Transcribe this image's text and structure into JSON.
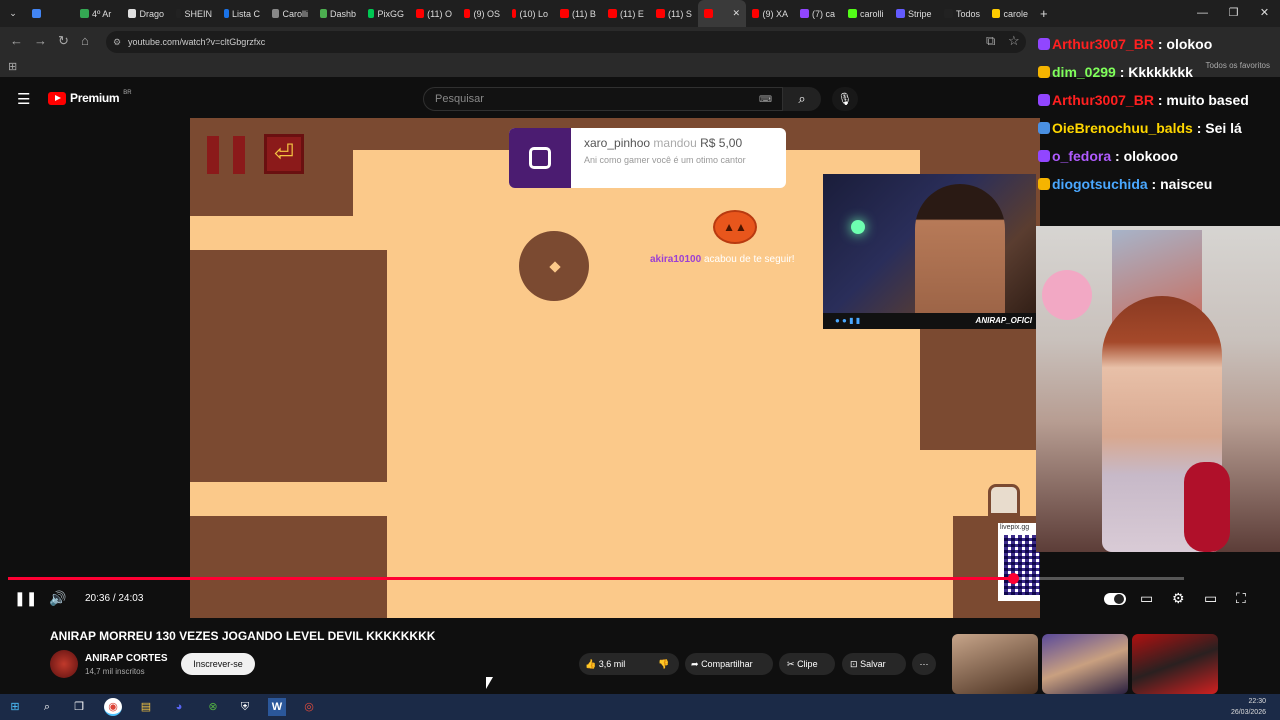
{
  "browser": {
    "tabs": [
      {
        "label": "",
        "color": "#4285f4"
      },
      {
        "label": "4º Ar",
        "color": "#34a853"
      },
      {
        "label": "Drago",
        "color": "#e0e0e0"
      },
      {
        "label": "SHEIN",
        "color": "#222222"
      },
      {
        "label": "Lista C",
        "color": "#1a73e8"
      },
      {
        "label": "Carolli",
        "color": "#888888"
      },
      {
        "label": "Dashb",
        "color": "#4caf50"
      },
      {
        "label": "PixGG",
        "color": "#00c853"
      },
      {
        "label": "(11) O",
        "color": "#ff0000"
      },
      {
        "label": "(9) OS",
        "color": "#ff0000"
      },
      {
        "label": "(10) Lo",
        "color": "#ff0000"
      },
      {
        "label": "(11) B",
        "color": "#ff0000"
      },
      {
        "label": "(11) E",
        "color": "#ff0000"
      },
      {
        "label": "(11) S",
        "color": "#ff0000"
      },
      {
        "label": "",
        "color": "#ff0000"
      },
      {
        "label": "(9) XA",
        "color": "#ff0000"
      },
      {
        "label": "(7) ca",
        "color": "#9146ff"
      },
      {
        "label": "carolli",
        "color": "#53fc18"
      },
      {
        "label": "Stripe",
        "color": "#635bff"
      },
      {
        "label": "Todos",
        "color": "#222222"
      },
      {
        "label": "carole",
        "color": "#ffcc00"
      }
    ],
    "url": "youtube.com/watch?v=cltGbgrzfxc",
    "bookmarks_label": "Todos os favoritos"
  },
  "youtube": {
    "logo_text": "Premium",
    "logo_sup": "BR",
    "search_placeholder": "Pesquisar"
  },
  "stream": {
    "donation_user": "xaro_pinhoo",
    "donation_verb": "mandou",
    "donation_amount": "R$ 5,00",
    "donation_message": "Ani como gamer você é um otimo cantor",
    "follow_user": "akira10100",
    "follow_text": "acabou de te seguir!",
    "webcam_label": "ANIRAP_OFICI",
    "qr_label": "livepix.gg"
  },
  "chat": [
    {
      "user": "Arthur3007_BR",
      "text": "olokoo",
      "color": "#ff2020",
      "badge": "#9146ff"
    },
    {
      "user": "dim_0299",
      "text": "Kkkkkkkk",
      "color": "#7fff5a",
      "badge": "#f5b400"
    },
    {
      "user": "Arthur3007_BR",
      "text": "muito based",
      "color": "#ff2020",
      "badge": "#9146ff"
    },
    {
      "user": "OieBrenochuu_balds",
      "text": "Sei lá",
      "color": "#ffd700",
      "badge": "#4a90e2"
    },
    {
      "user": "o_fedora",
      "text": "olokooo",
      "color": "#b05bff",
      "badge": "#9146ff"
    },
    {
      "user": "diogotsuchida",
      "text": "naisceu",
      "color": "#4aa8ff",
      "badge": "#f5b400"
    }
  ],
  "player": {
    "time_current": "20:36",
    "time_total": "24:03",
    "progress": 0.855
  },
  "video": {
    "title": "ANIRAP MORREU 130 VEZES JOGANDO LEVEL DEVIL KKKKKKKK",
    "channel": "ANIRAP CORTES",
    "subscribers": "14,7 mil inscritos",
    "subscribe_label": "Inscrever-se",
    "likes": "3,6 mil",
    "share_label": "Compartilhar",
    "clip_label": "Clipe",
    "save_label": "Salvar"
  },
  "taskbar": {
    "time": "22:30",
    "date": "26/03/2026"
  }
}
